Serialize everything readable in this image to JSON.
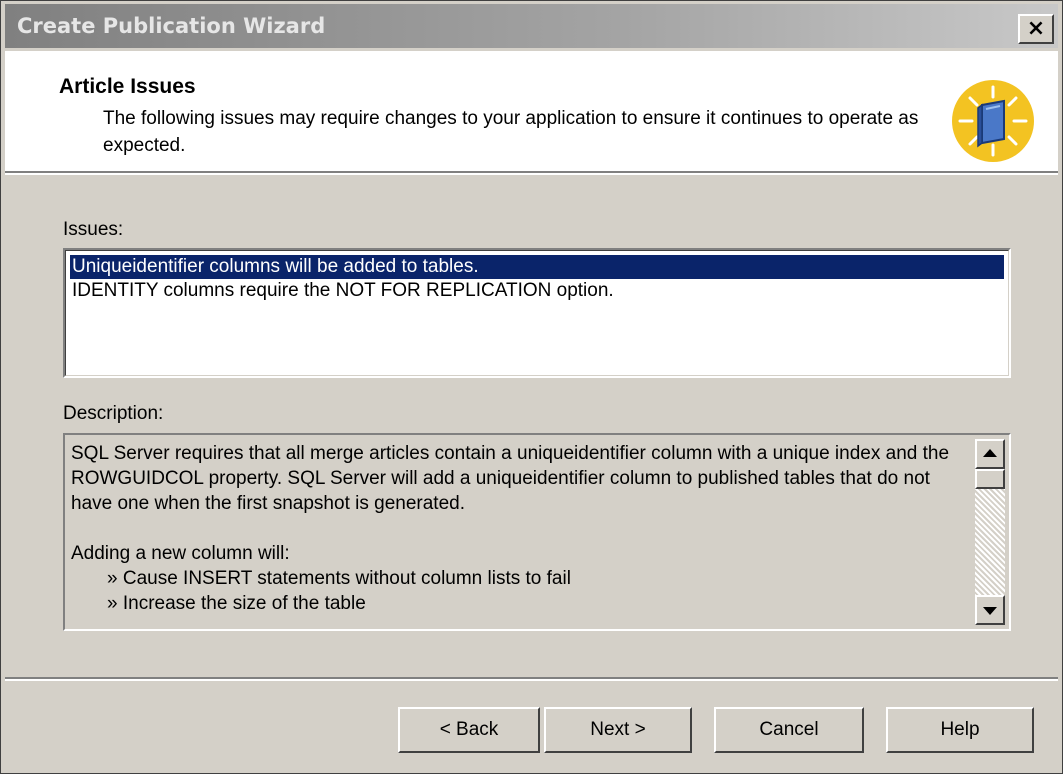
{
  "window": {
    "title": "Create Publication Wizard",
    "close_label": "×"
  },
  "header": {
    "title": "Article Issues",
    "description": "The following issues may require changes to your application to ensure it continues to operate as expected.",
    "icon": "wizard-book-icon"
  },
  "issues": {
    "label": "Issues:",
    "items": [
      {
        "text": "Uniqueidentifier columns will be added to tables.",
        "selected": true
      },
      {
        "text": "IDENTITY columns require the NOT FOR REPLICATION option.",
        "selected": false
      }
    ]
  },
  "description": {
    "label": "Description:",
    "paragraph1": "SQL Server requires that all merge articles contain a uniqueidentifier column with a unique index and the ROWGUIDCOL property. SQL Server will add a uniqueidentifier column to published tables that do not have one when the first snapshot is generated.",
    "paragraph2": "Adding a new column will:",
    "bullets": [
      "» Cause INSERT statements without column lists to fail",
      "» Increase the size of the table"
    ]
  },
  "buttons": {
    "back": "< Back",
    "next": "Next >",
    "cancel": "Cancel",
    "help": "Help"
  },
  "colors": {
    "selection": "#0a246a",
    "dialog_face": "#d4d0c8",
    "header_background": "#ffffff"
  }
}
